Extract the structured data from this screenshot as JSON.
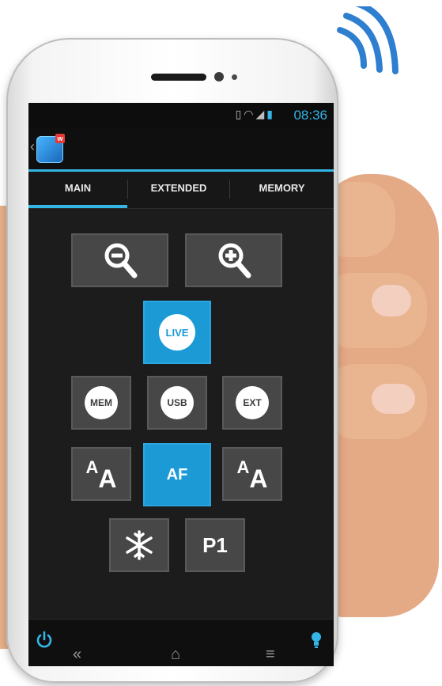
{
  "status_bar": {
    "time": "08:36",
    "icons": [
      "vibrate-icon",
      "wifi-icon",
      "signal-icon",
      "battery-icon"
    ]
  },
  "action_bar": {
    "app_icon": "camera-remote-app-icon",
    "badge": "w"
  },
  "tabs": [
    {
      "label": "MAIN",
      "selected": true
    },
    {
      "label": "EXTENDED",
      "selected": false
    },
    {
      "label": "MEMORY",
      "selected": false
    }
  ],
  "controls": {
    "zoom_out": "zoom-out-icon",
    "zoom_in": "zoom-in-icon",
    "live": "LIVE",
    "mem": "MEM",
    "usb": "USB",
    "ext": "EXT",
    "font_small_large": {
      "small": "A",
      "large": "A"
    },
    "af": "AF",
    "font_large_small": {
      "small": "A",
      "large": "A"
    },
    "freeze": "snowflake-icon",
    "p1": "P1"
  },
  "bottom_bar": {
    "power": "power-icon",
    "light": "bulb-icon"
  },
  "nav": {
    "back": "«",
    "home": "⌂",
    "menu": "≡"
  },
  "colors": {
    "accent": "#33b5e5",
    "button": "#474747",
    "active": "#1b9ad6"
  }
}
